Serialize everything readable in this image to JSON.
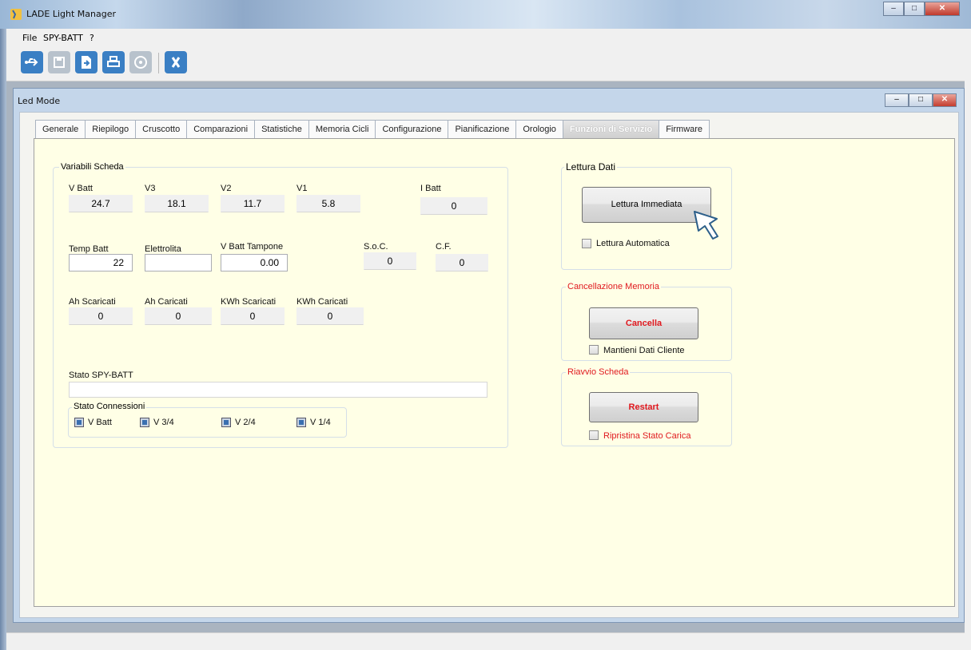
{
  "window": {
    "title": "LADE Light Manager"
  },
  "menu": [
    "File",
    "SPY-BATT",
    "?"
  ],
  "toolbar": {
    "buttons": [
      {
        "icon": "usb-connect-icon",
        "color": "#3a7fc4"
      },
      {
        "icon": "save-icon",
        "color": "#b8c2cc"
      },
      {
        "icon": "open-file-icon",
        "color": "#3a7fc4"
      },
      {
        "icon": "print-icon",
        "color": "#3a7fc4"
      },
      {
        "icon": "disc-icon",
        "color": "#b8c2cc"
      },
      {
        "icon": "close-x-icon",
        "color": "#3a7fc4"
      }
    ]
  },
  "child_window": {
    "title": "Led Mode"
  },
  "tabs": [
    "Generale",
    "Riepilogo",
    "Cruscotto",
    "Comparazioni",
    "Statistiche",
    "Memoria Cicli",
    "Configurazione",
    "Pianificazione",
    "Orologio",
    "Funzioni di Servizio",
    "Firmware"
  ],
  "active_tab": "Funzioni di Servizio",
  "variabili": {
    "title": "Variabili Scheda",
    "vbatt": {
      "label": "V Batt",
      "value": "24.7"
    },
    "v3": {
      "label": "V3",
      "value": "18.1"
    },
    "v2": {
      "label": "V2",
      "value": "11.7"
    },
    "v1": {
      "label": "V1",
      "value": "5.8"
    },
    "ibatt": {
      "label": "I Batt",
      "value": "0"
    },
    "temp_batt": {
      "label": "Temp Batt",
      "value": "22"
    },
    "elettrolita": {
      "label": "Elettrolita",
      "value": ""
    },
    "vbatt_tampone": {
      "label": "V Batt Tampone",
      "value": "0.00"
    },
    "soc": {
      "label": "S.o.C.",
      "value": "0"
    },
    "cf": {
      "label": "C.F.",
      "value": "0"
    },
    "ah_scaricati": {
      "label": "Ah Scaricati",
      "value": "0"
    },
    "ah_caricati": {
      "label": "Ah Caricati",
      "value": "0"
    },
    "kwh_scaricati": {
      "label": "KWh Scaricati",
      "value": "0"
    },
    "kwh_caricati": {
      "label": "KWh Caricati",
      "value": "0"
    },
    "stato_label": "Stato SPY-BATT",
    "stato_value": "",
    "connessioni": {
      "title": "Stato Connessioni",
      "items": [
        "V Batt",
        "V 3/4",
        "V 2/4",
        "V 1/4"
      ]
    }
  },
  "lettura": {
    "title": "Lettura Dati",
    "button": "Lettura Immediata",
    "auto_label": "Lettura Automatica"
  },
  "cancellazione": {
    "title": "Cancellazione Memoria",
    "button": "Cancella",
    "option": "Mantieni Dati Cliente"
  },
  "riavvio": {
    "title": "Riavvio Scheda",
    "button": "Restart",
    "option": "Ripristina Stato Carica"
  },
  "colors": {
    "red_accent": "#e0191f",
    "panel_bg": "#ffffe6",
    "active_tab": "#d0d0d0"
  }
}
